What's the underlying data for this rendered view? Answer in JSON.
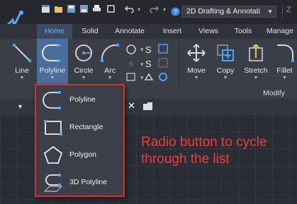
{
  "title_bar": {
    "workspace": "2D Drafting & Annotati",
    "trailing_char": "Z",
    "icons": [
      "new-icon",
      "open-icon",
      "save-icon",
      "saveas-icon",
      "print-icon",
      "plot-icon",
      "undo-icon",
      "redo-icon",
      "help-icon"
    ]
  },
  "tabs": [
    "Home",
    "Solid",
    "Annotate",
    "Insert",
    "Views",
    "Tools",
    "Manage"
  ],
  "active_tab": "Home",
  "ribbon": {
    "tools": {
      "line": "Line",
      "polyline": "Polyline",
      "circle": "Circle",
      "arc": "Arc",
      "move": "Move",
      "copy": "Copy",
      "stretch": "Stretch",
      "fillet": "Fillet"
    },
    "modify_panel_title": "Modify",
    "accent": "#4a6e9c"
  },
  "flyout": {
    "items": [
      {
        "label": "Polyline",
        "icon": "polyline-icon"
      },
      {
        "label": "Rectangle",
        "icon": "rectangle-icon"
      },
      {
        "label": "Polygon",
        "icon": "polygon-icon"
      },
      {
        "label": "3D Polyline",
        "icon": "3d-polyline-icon"
      }
    ],
    "border_color": "#e02a2a"
  },
  "annotation": {
    "line1": "Radio button to cycle",
    "line2": "through the list",
    "color": "#f03c3c"
  }
}
